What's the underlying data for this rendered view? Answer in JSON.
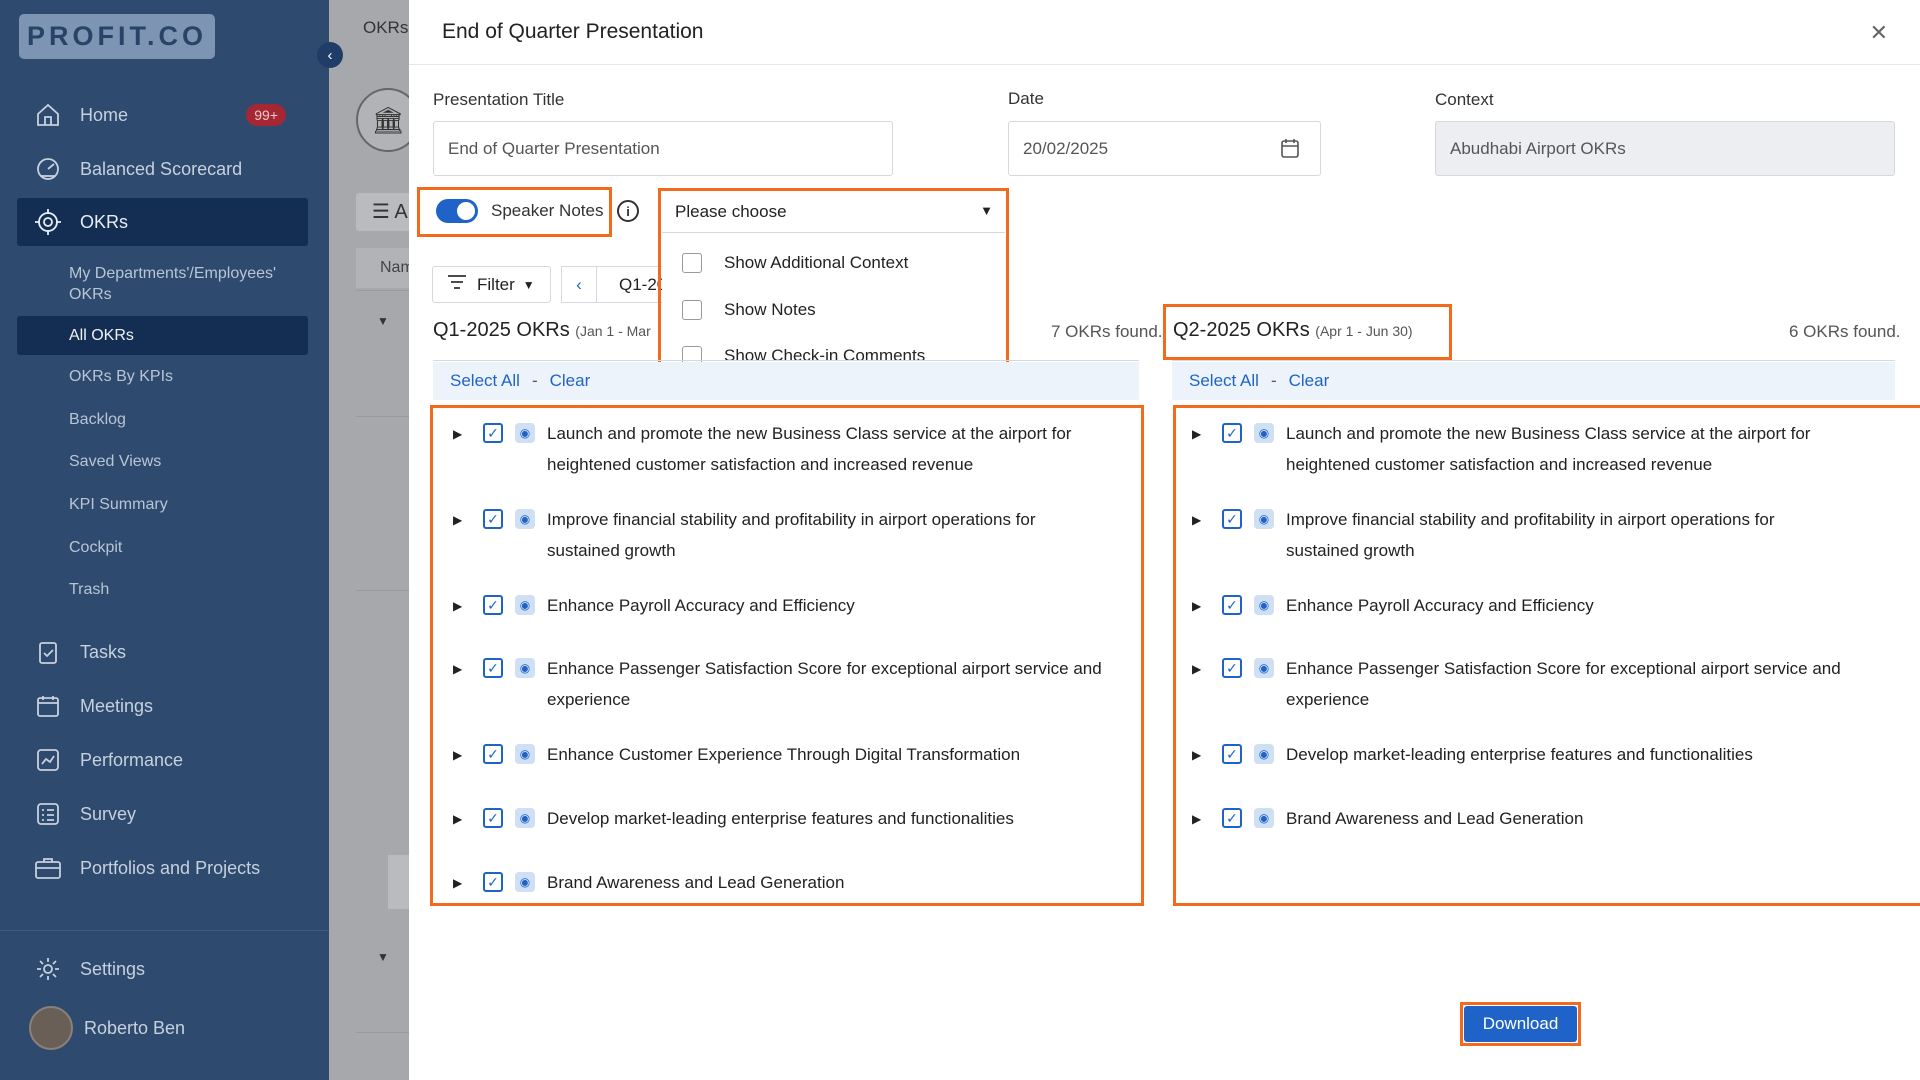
{
  "app": {
    "logo_text": "PROFIT.CO"
  },
  "sidebar": {
    "nav": [
      {
        "label": "Home",
        "icon": "home-icon",
        "badge": "99+"
      },
      {
        "label": "Balanced Scorecard",
        "icon": "scorecard-icon"
      },
      {
        "label": "OKRs",
        "icon": "target-icon",
        "active": true
      }
    ],
    "sub_items": [
      {
        "label": "My Departments'/Employees' OKRs"
      },
      {
        "label": "All OKRs",
        "active": true
      },
      {
        "label": "OKRs By KPIs"
      },
      {
        "label": "Backlog"
      },
      {
        "label": "Saved Views"
      },
      {
        "label": "KPI Summary"
      },
      {
        "label": "Cockpit"
      },
      {
        "label": "Trash"
      }
    ],
    "nav2": [
      {
        "label": "Tasks",
        "icon": "clipboard-check-icon"
      },
      {
        "label": "Meetings",
        "icon": "calendar-icon"
      },
      {
        "label": "Performance",
        "icon": "trend-icon"
      },
      {
        "label": "Survey",
        "icon": "survey-list-icon"
      },
      {
        "label": "Portfolios and Projects",
        "icon": "briefcase-icon"
      }
    ],
    "settings_label": "Settings",
    "user_name": "Roberto Ben"
  },
  "background": {
    "okrs_label": "OKRs",
    "name_label": "Nam",
    "menu_label": "A"
  },
  "modal": {
    "title": "End of Quarter Presentation",
    "presentation_title_label": "Presentation Title",
    "presentation_title_value": "End of Quarter Presentation",
    "date_label": "Date",
    "date_value": "20/02/2025",
    "context_label": "Context",
    "context_value": "Abudhabi Airport OKRs",
    "speaker_notes_label": "Speaker Notes",
    "speaker_notes_on": true,
    "dropdown": {
      "placeholder": "Please choose",
      "options": [
        "Show Additional Context",
        "Show Notes",
        "Show Check-in Comments"
      ]
    },
    "filter_label": "Filter",
    "period_label": "Q1-20",
    "select_all_label": "Select All",
    "clear_label": "Clear",
    "download_label": "Download",
    "q1": {
      "title": "Q1-2025 OKRs",
      "range": "(Jan 1 - Mar",
      "count": "7 OKRs found.",
      "items": [
        "Launch and promote the new Business Class service at the airport for heightened customer satisfaction and increased revenue",
        "Improve financial stability and profitability in airport operations for sustained growth",
        "Enhance Payroll Accuracy and Efficiency",
        "Enhance Passenger Satisfaction Score for exceptional airport service and experience",
        "Enhance Customer Experience Through Digital Transformation",
        "Develop market-leading enterprise features and functionalities",
        "Brand Awareness and Lead Generation"
      ]
    },
    "q2": {
      "title": "Q2-2025 OKRs",
      "range": "(Apr 1 - Jun 30)",
      "count": "6 OKRs found.",
      "items": [
        "Launch and promote the new Business Class service at the airport for heightened customer satisfaction and increased revenue",
        "Improve financial stability and profitability in airport operations for sustained growth",
        "Enhance Payroll Accuracy and Efficiency",
        "Enhance Passenger Satisfaction Score for exceptional airport service and experience",
        "Develop market-leading enterprise features and functionalities",
        "Brand Awareness and Lead Generation"
      ]
    }
  },
  "colors": {
    "sidebar_bg": "#2e4a6e",
    "accent": "#1f63c8",
    "highlight": "#f26a1b",
    "badge": "#a52733"
  }
}
